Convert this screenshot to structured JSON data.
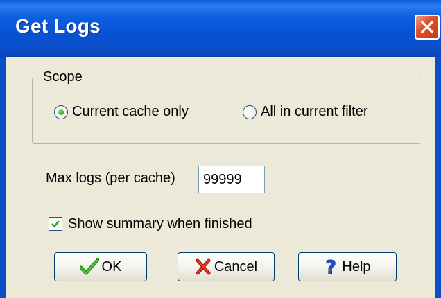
{
  "window": {
    "title": "Get Logs",
    "close_icon": "close-icon"
  },
  "scope": {
    "legend": "Scope",
    "options": [
      {
        "label": "Current cache only",
        "selected": true
      },
      {
        "label": "All in current filter",
        "selected": false
      }
    ]
  },
  "max_logs": {
    "label": "Max logs (per cache)",
    "value": "99999"
  },
  "summary": {
    "label": "Show summary when finished",
    "checked": true
  },
  "buttons": {
    "ok": {
      "label": "OK",
      "icon": "checkmark-icon"
    },
    "cancel": {
      "label": "Cancel",
      "icon": "x-icon"
    },
    "help": {
      "label": "Help",
      "icon": "question-mark-icon"
    }
  },
  "colors": {
    "titlebar": "#0853d4",
    "dialog_bg": "#ece9d8",
    "close": "#e0502a",
    "ok_icon": "#2ca01e",
    "cancel_icon": "#c81a0a",
    "help_icon": "#1c4fd8"
  }
}
